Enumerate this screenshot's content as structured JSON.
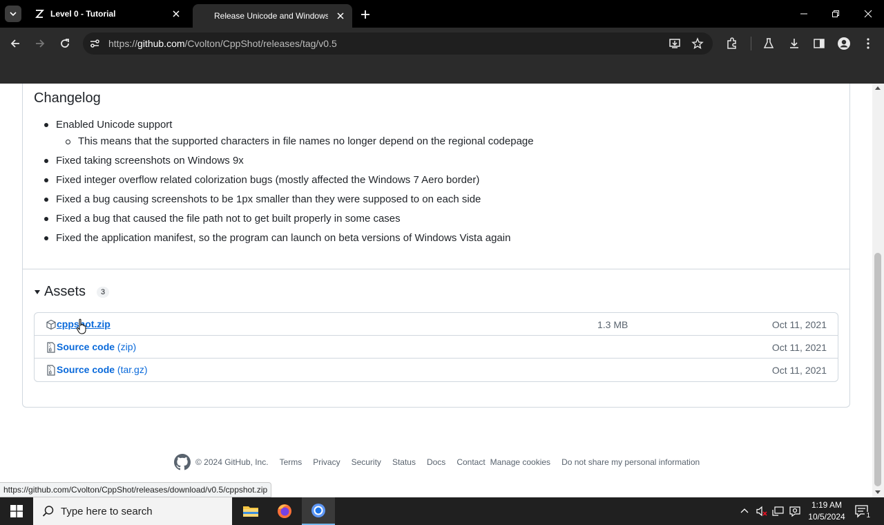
{
  "browser": {
    "tabs": [
      {
        "title": "Level 0 - Tutorial",
        "favicon": "zeta-icon",
        "active": false
      },
      {
        "title": "Release Unicode and Windows",
        "favicon": "github-icon",
        "active": true
      }
    ],
    "url_prefix": "https://",
    "url_domain": "github.com",
    "url_path": "/Cvolton/CppShot/releases/tag/v0.5"
  },
  "page": {
    "changelog_title": "Changelog",
    "changelog": [
      {
        "text": "Enabled Unicode support",
        "sub": [
          "This means that the supported characters in file names no longer depend on the regional codepage"
        ]
      },
      {
        "text": "Fixed taking screenshots on Windows 9x",
        "sub": []
      },
      {
        "text": "Fixed integer overflow related colorization bugs (mostly affected the Windows 7 Aero border)",
        "sub": []
      },
      {
        "text": "Fixed a bug causing screenshots to be 1px smaller than they were supposed to on each side",
        "sub": []
      },
      {
        "text": "Fixed a bug that caused the file path not to get built properly in some cases",
        "sub": []
      },
      {
        "text": "Fixed the application manifest, so the program can launch on beta versions of Windows Vista again",
        "sub": []
      }
    ],
    "assets_title": "Assets",
    "assets_count": "3",
    "assets": [
      {
        "name": "cppshot.zip",
        "ext": "",
        "size": "1.3 MB",
        "date": "Oct 11, 2021",
        "icon": "package-icon"
      },
      {
        "name": "Source code",
        "ext": "(zip)",
        "size": "",
        "date": "Oct 11, 2021",
        "icon": "file-zip-icon"
      },
      {
        "name": "Source code",
        "ext": "(tar.gz)",
        "size": "",
        "date": "Oct 11, 2021",
        "icon": "file-zip-icon"
      }
    ],
    "footer": {
      "copyright": "© 2024 GitHub, Inc.",
      "links": [
        "Terms",
        "Privacy",
        "Security",
        "Status",
        "Docs",
        "Contact",
        "Manage cookies",
        "Do not share my personal information"
      ]
    }
  },
  "status_bar": {
    "url": "https://github.com/Cvolton/CppShot/releases/download/v0.5/cppshot.zip"
  },
  "taskbar": {
    "search_placeholder": "Type here to search",
    "time": "1:19 AM",
    "date": "10/5/2024",
    "notification_count": "1"
  },
  "colors": {
    "link": "#0969da",
    "muted": "#59636e",
    "border": "#d0d7de",
    "chrome_dark": "#2b2b2b"
  }
}
